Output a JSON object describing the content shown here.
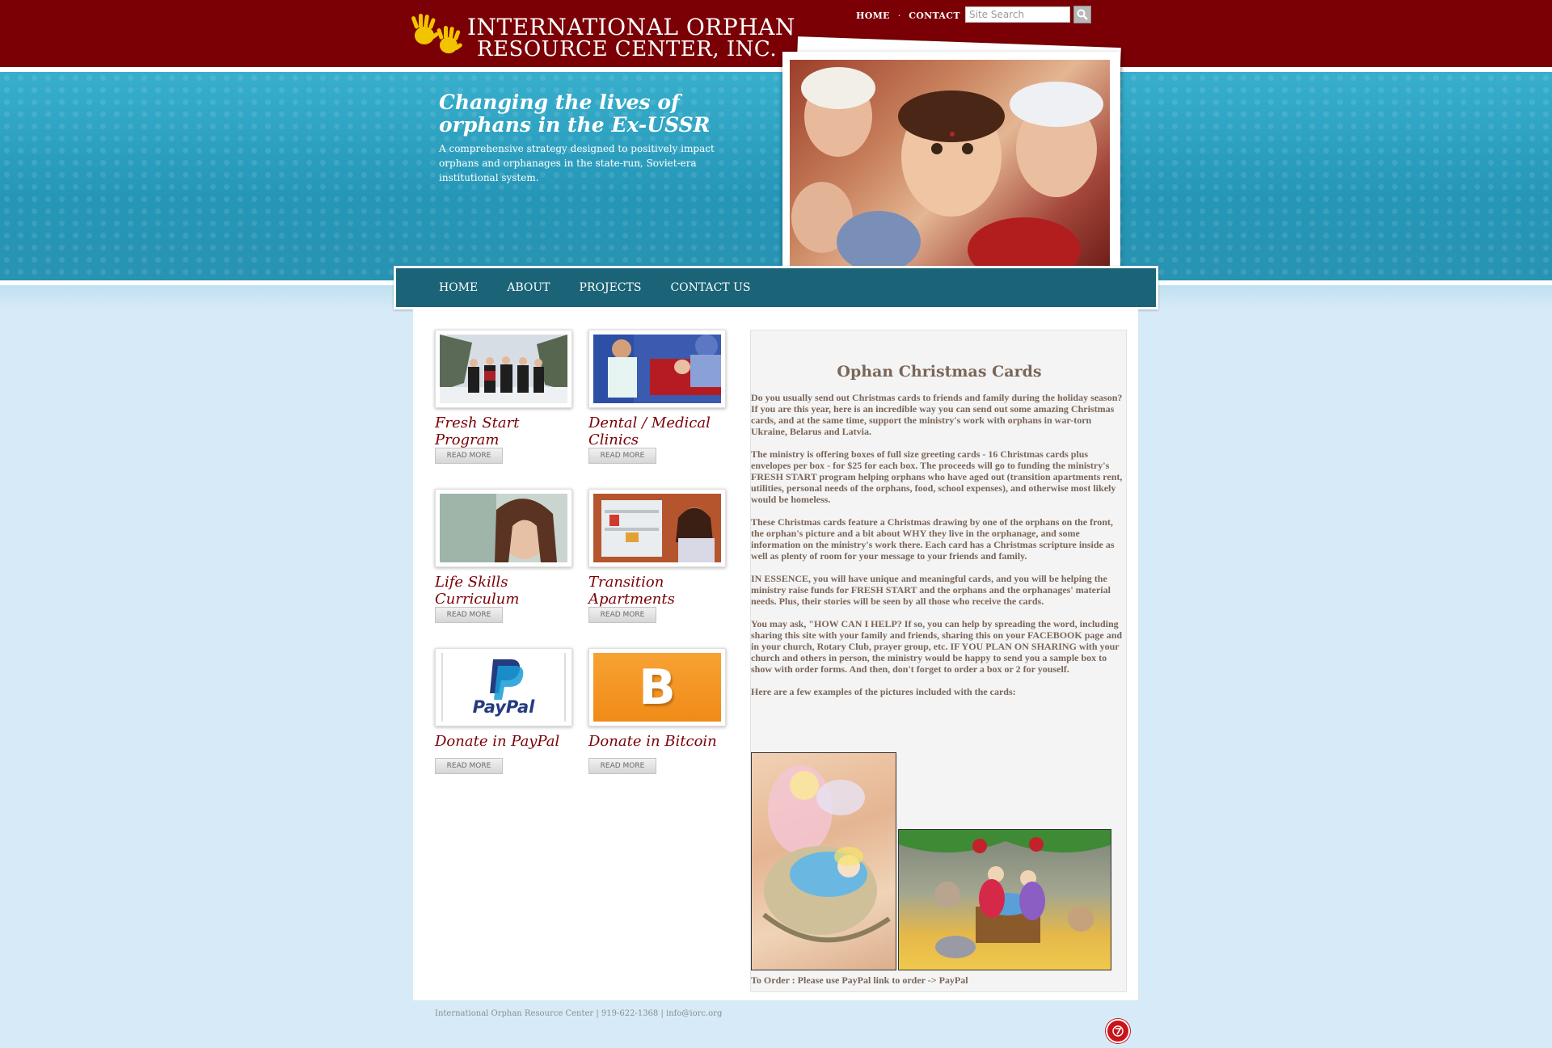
{
  "logo": {
    "line1": "INTERNATIONAL ORPHAN",
    "line2": "RESOURCE CENTER, INC."
  },
  "topnav": {
    "home": "HOME",
    "separator": "·",
    "contact": "CONTACT"
  },
  "search": {
    "placeholder": "Site Search",
    "icon": "search-icon"
  },
  "hero": {
    "title": "Changing the lives of orphans in the Ex-USSR",
    "subtitle": "A comprehensive strategy designed to positively impact orphans and orphanages in the state-run, Soviet-era institutional system."
  },
  "mainnav": {
    "items": [
      "HOME",
      "ABOUT",
      "PROJECTS",
      "CONTACT US"
    ]
  },
  "cards": [
    {
      "title": "Fresh Start Program",
      "readmore": "READ MORE"
    },
    {
      "title": "Dental / Medical Clinics",
      "readmore": "READ MORE"
    },
    {
      "title": "Life Skills Curriculum",
      "readmore": "READ MORE"
    },
    {
      "title": "Transition Apartments",
      "readmore": "READ MORE"
    },
    {
      "title": "Donate in PayPal",
      "readmore": "READ MORE",
      "logo_text": "PayPal"
    },
    {
      "title": "Donate in Bitcoin",
      "readmore": "READ MORE",
      "logo_text": "B"
    }
  ],
  "article": {
    "title": "Ophan Christmas Cards",
    "paragraphs": [
      "Do you usually send out Christmas cards to friends and family during the holiday season?  If you are this year, here is an incredible way you can send out some amazing Christmas cards, and at the same time, support the ministry's work with orphans in war-torn Ukraine, Belarus and Latvia.",
      "The ministry is offering boxes of full size greeting cards - 16 Christmas cards plus envelopes per box - for $25 for each box.  The proceeds will go to funding the ministry's FRESH START program helping orphans who have aged out (transition apartments rent, utilities, personal needs of the orphans, food, school expenses), and otherwise most likely would be homeless.",
      "These Christmas cards feature a Christmas drawing by one of the orphans on the front, the orphan's picture and a bit about WHY they live in the orphanage, and some information on the ministry's work there.  Each card has a Christmas scripture inside as well as plenty of room for your message to your friends and family.",
      "IN ESSENCE, you will have unique and meaningful cards, and you will be helping the ministry raise funds for FRESH START and the orphans and the orphanages' material needs.  Plus, their stories will be seen by all those who receive the cards.",
      "You may ask, \"HOW CAN I HELP?  If so, you can help by spreading the word, including sharing this site with your family and friends, sharing this on your FACEBOOK page and in your church, Rotary Club, prayer group, etc.  IF YOU PLAN ON SHARING with your church and others in person, the ministry would be happy to send you a sample box to show with order forms. And then, don't forget to order a box or 2 for youself.",
      "Here are a few examples of the pictures included with the cards:"
    ],
    "order_line": "To Order : Please use PayPal link to order -> PayPal"
  },
  "footer": {
    "text": "International Orphan Resource Center | 919-622-1368 | info@iorc.org",
    "badge_icon": "site-badge-icon"
  },
  "colors": {
    "brand_red": "#7a0006",
    "hero_teal": "#2a9cbc",
    "nav_teal": "#1b6376",
    "page_bg": "#d6ebf7",
    "article_text": "#7b6658"
  }
}
